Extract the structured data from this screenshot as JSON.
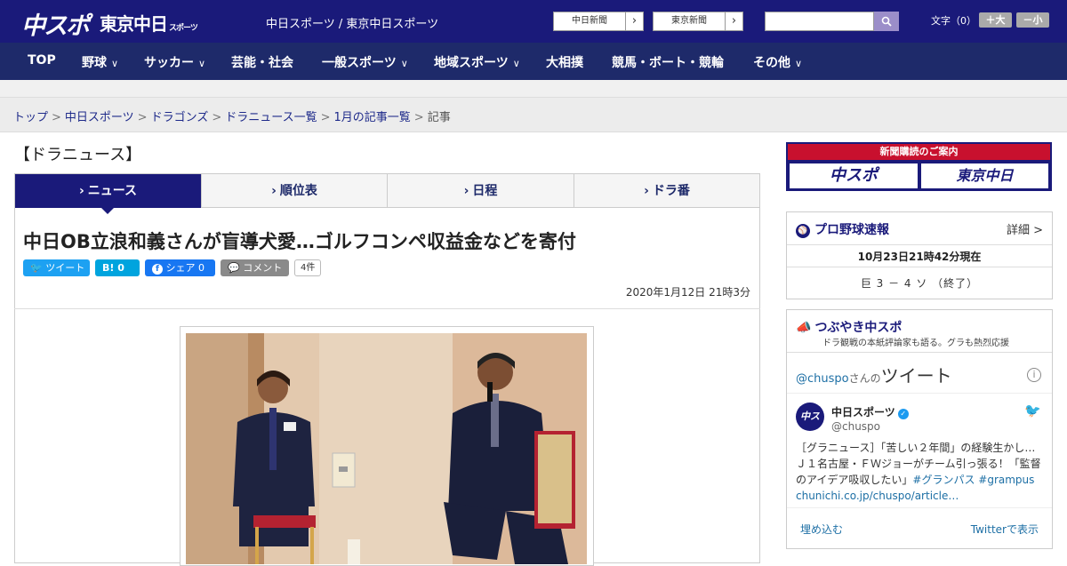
{
  "header": {
    "logo_main": "中スポ",
    "logo_tokyo": "東京中日",
    "logo_tokyo_sub": "スポーツ",
    "site_title": "中日スポーツ / 東京中日スポーツ",
    "paper_buttons": [
      "中日新聞",
      "東京新聞"
    ],
    "search_placeholder": "",
    "font_size_label": "文字（0）",
    "font_increase": "＋大",
    "font_decrease": "－小"
  },
  "nav": {
    "items": [
      "TOP",
      "野球",
      "サッカー",
      "芸能・社会",
      "一般スポーツ",
      "地域スポーツ",
      "大相撲",
      "競馬・ボート・競輪",
      "その他"
    ]
  },
  "breadcrumb": [
    "トップ",
    "中日スポーツ",
    "ドラゴンズ",
    "ドラニュース一覧",
    "1月の記事一覧",
    "記事"
  ],
  "section_title": "【ドラニュース】",
  "tabs": [
    "ニュース",
    "順位表",
    "日程",
    "ドラ番"
  ],
  "article": {
    "headline": "中日OB立浪和義さんが盲導犬愛…ゴルフコンペ収益金などを寄付",
    "share": {
      "tweet": "ツイート",
      "hatena": "B! 0",
      "facebook": "シェア 0",
      "comment": "コメント",
      "comment_count": "4件"
    },
    "date": "2020年1月12日 21時3分"
  },
  "sidebar": {
    "promo_title": "新聞購読のご案内",
    "promo_logos": [
      "中スポ",
      "東京中日"
    ],
    "baseball": {
      "title": "プロ野球速報",
      "detail": "詳細 >",
      "time": "10月23日21時42分現在",
      "score": "巨 3 － 4 ソ （終了）"
    },
    "tweets": {
      "title": "つぶやき中スポ",
      "subtitle": "ドラ観戦の本紙評論家も語る。グラも熱烈応援",
      "handle": "@chuspo",
      "handle_suffix": "さんの",
      "handle_big": "ツイート",
      "author": "中日スポーツ",
      "author_handle": "@chuspo",
      "avatar": "中スポ",
      "text": "［グラニュース］「苦しい２年間」の経験生かし…Ｊ１名古屋・ＦＷジョーがチーム引っ張る！「監督のアイデア吸収したい」",
      "tags": "#グランパス #grampus",
      "link": "chunichi.co.jp/chuspo/article…",
      "embed": "埋め込む",
      "view_on_twitter": "Twitterで表示"
    }
  }
}
